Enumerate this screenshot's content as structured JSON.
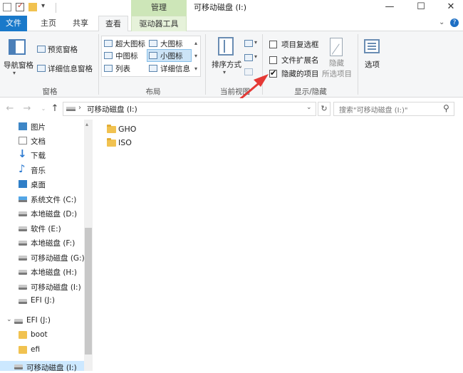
{
  "window": {
    "title": "可移动磁盘 (I:)",
    "context_tab": "管理",
    "controls": {
      "minimize": "—",
      "maximize": "☐",
      "close": "✕"
    }
  },
  "tabs": {
    "file": "文件",
    "home": "主页",
    "share": "共享",
    "view": "查看",
    "drive_tools": "驱动器工具"
  },
  "ribbon": {
    "panes": {
      "nav_pane": "导航窗格",
      "preview_pane": "预览窗格",
      "details_pane": "详细信息窗格",
      "group": "窗格"
    },
    "layout": {
      "extra_large": "超大图标",
      "large": "大图标",
      "medium": "中图标",
      "small": "小图标",
      "list": "列表",
      "details": "详细信息",
      "group": "布局"
    },
    "current_view": {
      "sort": "排序方式",
      "group": "当前视图"
    },
    "show_hide": {
      "item_checkboxes": "项目复选框",
      "file_extensions": "文件扩展名",
      "hidden_items": "隐藏的项目",
      "hide_selected_1": "隐藏",
      "hide_selected_2": "所选项目",
      "group": "显示/隐藏",
      "item_checkboxes_checked": false,
      "file_extensions_checked": false,
      "hidden_items_checked": true
    },
    "options": "选项"
  },
  "address": {
    "path": "可移动磁盘 (I:)",
    "search_placeholder": "搜索\"可移动磁盘 (I:)\""
  },
  "nav_pane": {
    "items": [
      {
        "label": "图片",
        "icon": "image-icon"
      },
      {
        "label": "文档",
        "icon": "document-icon"
      },
      {
        "label": "下载",
        "icon": "download-icon"
      },
      {
        "label": "音乐",
        "icon": "music-icon"
      },
      {
        "label": "桌面",
        "icon": "desktop-icon"
      },
      {
        "label": "系统文件 (C:)",
        "icon": "system-drive-icon"
      },
      {
        "label": "本地磁盘 (D:)",
        "icon": "drive-icon"
      },
      {
        "label": "软件 (E:)",
        "icon": "drive-icon"
      },
      {
        "label": "本地磁盘 (F:)",
        "icon": "drive-icon"
      },
      {
        "label": "可移动磁盘 (G:)",
        "icon": "drive-icon"
      },
      {
        "label": "本地磁盘 (H:)",
        "icon": "drive-icon"
      },
      {
        "label": "可移动磁盘 (I:)",
        "icon": "drive-icon"
      },
      {
        "label": "EFI (J:)",
        "icon": "drive-icon"
      },
      {
        "label": "EFI (J:)",
        "icon": "drive-icon"
      },
      {
        "label": "boot",
        "icon": "folder-icon"
      },
      {
        "label": "efi",
        "icon": "folder-icon"
      },
      {
        "label": "可移动磁盘 (I:)",
        "icon": "drive-icon"
      }
    ]
  },
  "files": [
    {
      "name": "GHO"
    },
    {
      "name": "ISO"
    }
  ],
  "colors": {
    "file_tab": "#1979ca",
    "manage_tab": "#cde6b8",
    "selection": "#cce4f7",
    "arrow": "#e53935"
  }
}
